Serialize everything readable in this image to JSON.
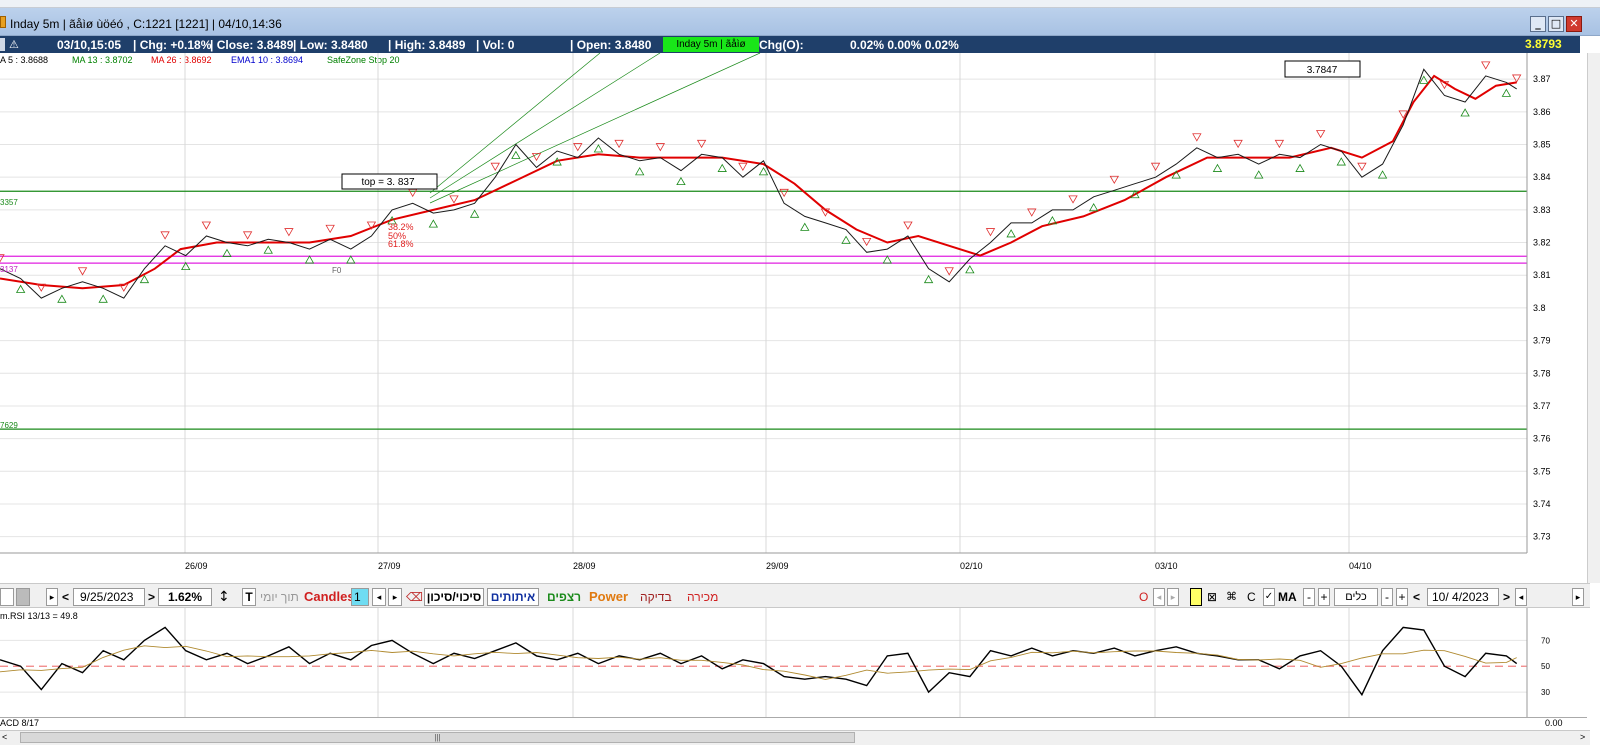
{
  "window": {
    "title": "Inday 5m | ãåìø ùöéó , C:1221 [1221] | 04/10,14:36",
    "buttons": [
      "_",
      "□",
      "✕"
    ]
  },
  "info_bar": {
    "datetime": "03/10,15:05",
    "chg": "| Chg: +0.18%",
    "close": "| Close: 3.8489",
    "low": "| Low: 3.8480",
    "high": "| High: 3.8489",
    "vol": "| Vol: 0",
    "open": "| Open: 3.8480",
    "tab": "Inday 5m | ãåìø",
    "chg_o_label": "Chg(O):",
    "chg_o_values": "0.02% 0.00% 0.02%",
    "last_price": "3.8793"
  },
  "ma_legend": [
    {
      "text": "A 5 : 3.8688",
      "color": "#000000"
    },
    {
      "text": "MA 13 : 3.8702",
      "color": "#008000"
    },
    {
      "text": "MA 26 : 3.8692",
      "color": "#e00000"
    },
    {
      "text": "EMA1 10 : 3.8694",
      "color": "#0000cc"
    },
    {
      "text": "SafeZone Stop 20",
      "color": "#008000"
    }
  ],
  "chart_data": {
    "type": "line",
    "title": "",
    "y_ticks": [
      "3.87",
      "3.86",
      "3.85",
      "3.84",
      "3.83",
      "3.82",
      "3.81",
      "3.8",
      "3.79",
      "3.78",
      "3.77",
      "3.76",
      "3.75",
      "3.74",
      "3.73"
    ],
    "ylim": [
      3.725,
      3.878
    ],
    "x_ticks": [
      "26/09",
      "27/09",
      "28/09",
      "29/09",
      "02/10",
      "03/10",
      "04/10"
    ],
    "annotations": {
      "top_label": "top = 3. 837",
      "box_label": "3.7847",
      "level_left_1": "3357",
      "level_left_2": "3137",
      "level_left_3": "7629",
      "fib_1": "38.2%",
      "fib_2": "50%",
      "fib_3": "61.8%",
      "f0": "F0"
    },
    "horizontal_levels": [
      {
        "value": 3.8357,
        "color": "#1a8a1a"
      },
      {
        "value": 3.8158,
        "color": "#e020e0"
      },
      {
        "value": 3.8137,
        "color": "#e020e0"
      },
      {
        "value": 3.7629,
        "color": "#1a8a1a"
      }
    ],
    "series": [
      {
        "name": "MA 26",
        "color": "#e00000",
        "points": [
          [
            0,
            3.809
          ],
          [
            40,
            3.807
          ],
          [
            80,
            3.806
          ],
          [
            120,
            3.807
          ],
          [
            150,
            3.812
          ],
          [
            175,
            3.818
          ],
          [
            210,
            3.82
          ],
          [
            260,
            3.82
          ],
          [
            300,
            3.82
          ],
          [
            340,
            3.822
          ],
          [
            380,
            3.827
          ],
          [
            420,
            3.83
          ],
          [
            460,
            3.833
          ],
          [
            500,
            3.839
          ],
          [
            540,
            3.845
          ],
          [
            580,
            3.847
          ],
          [
            620,
            3.846
          ],
          [
            660,
            3.846
          ],
          [
            700,
            3.846
          ],
          [
            740,
            3.844
          ],
          [
            770,
            3.838
          ],
          [
            800,
            3.83
          ],
          [
            830,
            3.824
          ],
          [
            860,
            3.82
          ],
          [
            890,
            3.822
          ],
          [
            920,
            3.819
          ],
          [
            950,
            3.816
          ],
          [
            980,
            3.82
          ],
          [
            1010,
            3.825
          ],
          [
            1050,
            3.828
          ],
          [
            1090,
            3.833
          ],
          [
            1130,
            3.84
          ],
          [
            1170,
            3.846
          ],
          [
            1210,
            3.846
          ],
          [
            1250,
            3.846
          ],
          [
            1290,
            3.849
          ],
          [
            1320,
            3.846
          ],
          [
            1350,
            3.851
          ],
          [
            1370,
            3.863
          ],
          [
            1390,
            3.871
          ],
          [
            1410,
            3.867
          ],
          [
            1430,
            3.864
          ],
          [
            1450,
            3.868
          ],
          [
            1470,
            3.869
          ]
        ]
      },
      {
        "name": "Price",
        "color": "#1a1a1a",
        "points": [
          [
            0,
            3.812
          ],
          [
            20,
            3.809
          ],
          [
            40,
            3.803
          ],
          [
            60,
            3.806
          ],
          [
            80,
            3.808
          ],
          [
            100,
            3.806
          ],
          [
            120,
            3.803
          ],
          [
            140,
            3.812
          ],
          [
            160,
            3.819
          ],
          [
            180,
            3.816
          ],
          [
            200,
            3.822
          ],
          [
            220,
            3.82
          ],
          [
            240,
            3.819
          ],
          [
            260,
            3.821
          ],
          [
            280,
            3.82
          ],
          [
            300,
            3.818
          ],
          [
            320,
            3.821
          ],
          [
            340,
            3.818
          ],
          [
            360,
            3.822
          ],
          [
            380,
            3.83
          ],
          [
            400,
            3.832
          ],
          [
            420,
            3.829
          ],
          [
            440,
            3.83
          ],
          [
            460,
            3.832
          ],
          [
            480,
            3.84
          ],
          [
            500,
            3.85
          ],
          [
            520,
            3.843
          ],
          [
            540,
            3.848
          ],
          [
            560,
            3.846
          ],
          [
            580,
            3.852
          ],
          [
            600,
            3.847
          ],
          [
            620,
            3.845
          ],
          [
            640,
            3.846
          ],
          [
            660,
            3.842
          ],
          [
            680,
            3.847
          ],
          [
            700,
            3.846
          ],
          [
            720,
            3.84
          ],
          [
            740,
            3.845
          ],
          [
            760,
            3.832
          ],
          [
            780,
            3.828
          ],
          [
            800,
            3.826
          ],
          [
            820,
            3.824
          ],
          [
            840,
            3.817
          ],
          [
            860,
            3.818
          ],
          [
            880,
            3.822
          ],
          [
            900,
            3.812
          ],
          [
            920,
            3.808
          ],
          [
            940,
            3.815
          ],
          [
            960,
            3.82
          ],
          [
            980,
            3.826
          ],
          [
            1000,
            3.826
          ],
          [
            1020,
            3.83
          ],
          [
            1040,
            3.83
          ],
          [
            1060,
            3.834
          ],
          [
            1080,
            3.836
          ],
          [
            1100,
            3.838
          ],
          [
            1120,
            3.84
          ],
          [
            1140,
            3.844
          ],
          [
            1160,
            3.849
          ],
          [
            1180,
            3.846
          ],
          [
            1200,
            3.847
          ],
          [
            1220,
            3.844
          ],
          [
            1240,
            3.847
          ],
          [
            1260,
            3.846
          ],
          [
            1280,
            3.85
          ],
          [
            1300,
            3.848
          ],
          [
            1320,
            3.84
          ],
          [
            1340,
            3.844
          ],
          [
            1360,
            3.856
          ],
          [
            1380,
            3.873
          ],
          [
            1400,
            3.865
          ],
          [
            1420,
            3.863
          ],
          [
            1440,
            3.871
          ],
          [
            1460,
            3.869
          ],
          [
            1470,
            3.867
          ]
        ]
      }
    ]
  },
  "toolbar": {
    "date": "9/25/2023",
    "pct": "1.62%",
    "t_label": "T",
    "intraday": "תוך יומי",
    "candles": "Candles",
    "candles_num": "1",
    "risk": "סיכוי/סיכון",
    "signals": "איתותים",
    "continuous": "רצפים",
    "power": "Power",
    "check": "בדיקה",
    "sale": "מכירה",
    "o_label": "O",
    "c_label": "C",
    "ma_label": "MA",
    "tools_label": "כלים",
    "date2": "10/ 4/2023"
  },
  "rsi": {
    "label": "m.RSI 13/13 = 49.8",
    "levels": [
      "70",
      "50",
      "30"
    ],
    "points": [
      [
        0,
        55
      ],
      [
        20,
        50
      ],
      [
        40,
        32
      ],
      [
        60,
        52
      ],
      [
        80,
        45
      ],
      [
        100,
        62
      ],
      [
        120,
        55
      ],
      [
        140,
        70
      ],
      [
        160,
        80
      ],
      [
        180,
        62
      ],
      [
        200,
        55
      ],
      [
        220,
        60
      ],
      [
        240,
        52
      ],
      [
        260,
        58
      ],
      [
        280,
        65
      ],
      [
        300,
        52
      ],
      [
        320,
        60
      ],
      [
        340,
        55
      ],
      [
        360,
        66
      ],
      [
        380,
        70
      ],
      [
        400,
        60
      ],
      [
        420,
        52
      ],
      [
        440,
        60
      ],
      [
        460,
        56
      ],
      [
        480,
        62
      ],
      [
        500,
        68
      ],
      [
        520,
        58
      ],
      [
        540,
        55
      ],
      [
        560,
        60
      ],
      [
        580,
        52
      ],
      [
        600,
        58
      ],
      [
        620,
        55
      ],
      [
        640,
        60
      ],
      [
        660,
        52
      ],
      [
        680,
        58
      ],
      [
        700,
        48
      ],
      [
        720,
        55
      ],
      [
        740,
        52
      ],
      [
        760,
        42
      ],
      [
        780,
        40
      ],
      [
        800,
        42
      ],
      [
        820,
        40
      ],
      [
        840,
        35
      ],
      [
        860,
        58
      ],
      [
        880,
        60
      ],
      [
        900,
        30
      ],
      [
        920,
        45
      ],
      [
        940,
        42
      ],
      [
        960,
        62
      ],
      [
        980,
        58
      ],
      [
        1000,
        64
      ],
      [
        1020,
        58
      ],
      [
        1040,
        62
      ],
      [
        1060,
        60
      ],
      [
        1080,
        64
      ],
      [
        1100,
        58
      ],
      [
        1120,
        62
      ],
      [
        1140,
        65
      ],
      [
        1160,
        60
      ],
      [
        1180,
        58
      ],
      [
        1200,
        55
      ],
      [
        1220,
        55
      ],
      [
        1240,
        48
      ],
      [
        1260,
        58
      ],
      [
        1280,
        62
      ],
      [
        1300,
        50
      ],
      [
        1320,
        28
      ],
      [
        1340,
        62
      ],
      [
        1360,
        80
      ],
      [
        1380,
        78
      ],
      [
        1400,
        50
      ],
      [
        1420,
        42
      ],
      [
        1440,
        60
      ],
      [
        1460,
        58
      ],
      [
        1470,
        52
      ]
    ]
  },
  "macd": {
    "label": "ACD 8/17",
    "value": "0.00"
  }
}
